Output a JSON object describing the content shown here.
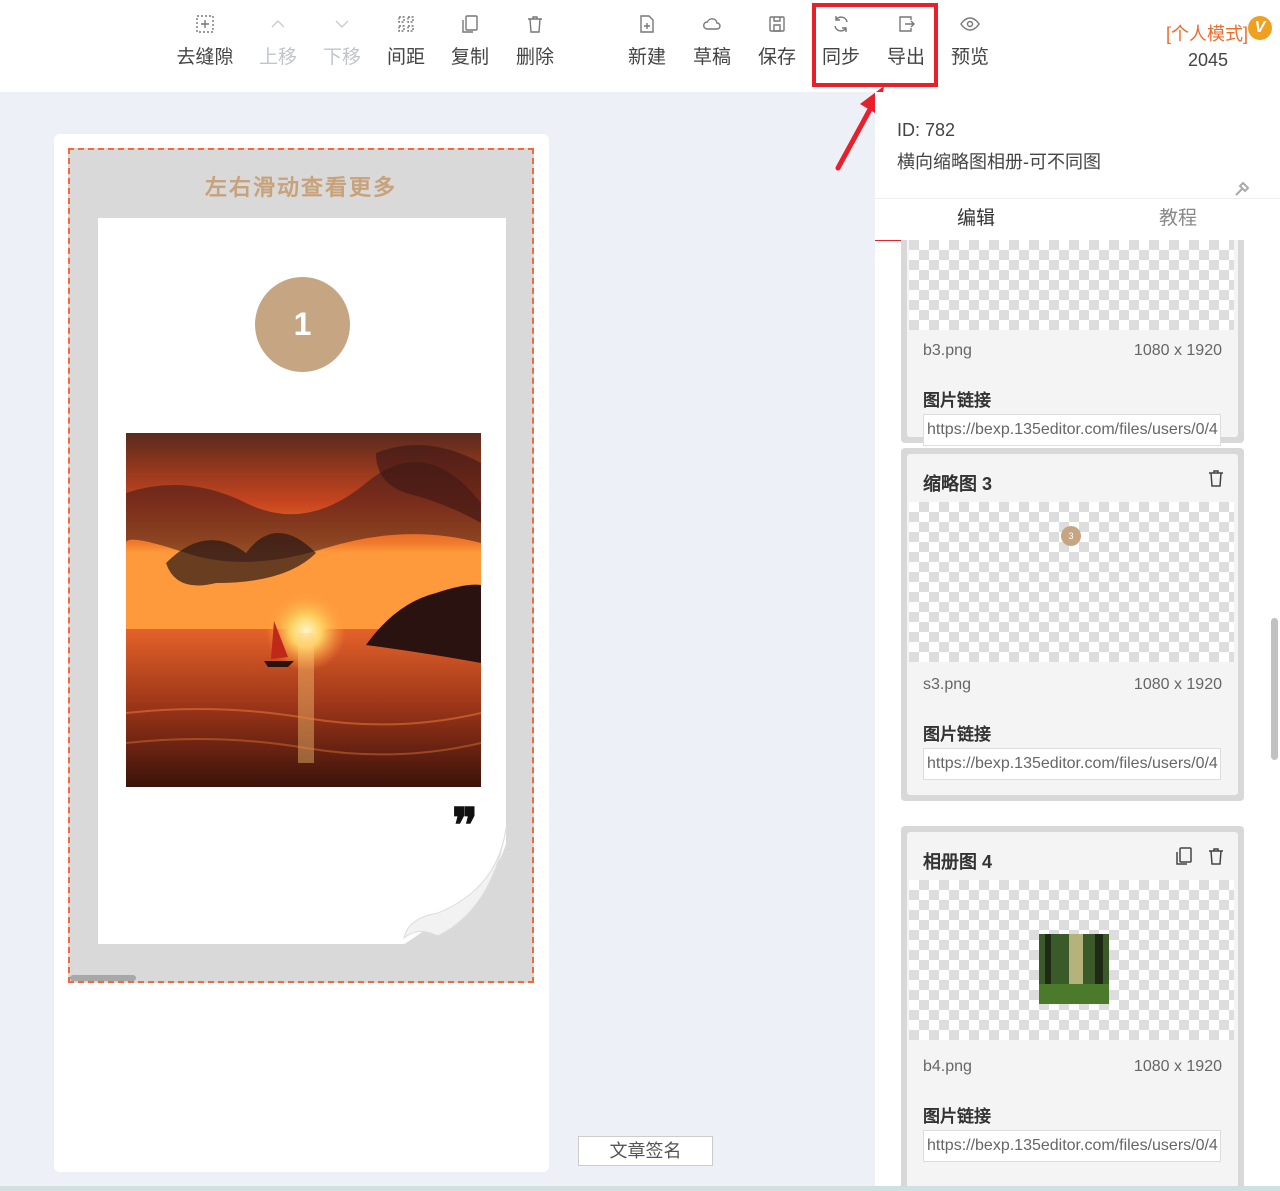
{
  "toolbar": {
    "remove_gap": "去缝隙",
    "move_up": "上移",
    "move_down": "下移",
    "spacing": "间距",
    "copy": "复制",
    "delete": "删除",
    "new": "新建",
    "draft": "草稿",
    "save": "保存",
    "sync": "同步",
    "export": "导出",
    "preview": "预览",
    "mode": "[个人模式]",
    "mode_badge": "V",
    "count": "2045"
  },
  "canvas": {
    "swipe_hint": "左右滑动查看更多",
    "slide_number": "1",
    "quote_mark": "❞",
    "signature_button": "文章签名"
  },
  "panel": {
    "id_label": "ID: 782",
    "template_name": "横向缩略图相册-可不同图",
    "tabs": [
      "编辑",
      "教程"
    ],
    "items": [
      {
        "file_name": "b3.png",
        "file_size": "1080 x 1920",
        "link_label": "图片链接",
        "link_value": "https://bexp.135editor.com/files/users/0/4"
      },
      {
        "title": "缩略图 3",
        "thumb_number": "3",
        "file_name": "s3.png",
        "file_size": "1080 x 1920",
        "link_label": "图片链接",
        "link_value": "https://bexp.135editor.com/files/users/0/4"
      },
      {
        "title": "相册图 4",
        "file_name": "b4.png",
        "file_size": "1080 x 1920",
        "link_label": "图片链接",
        "link_value": "https://bexp.135editor.com/files/users/0/4"
      }
    ]
  },
  "colors": {
    "accent_red": "#e8202b",
    "mode_orange": "#f06a2a",
    "circle_tan": "#c6a582",
    "swipe_tan": "#c8a27a"
  }
}
